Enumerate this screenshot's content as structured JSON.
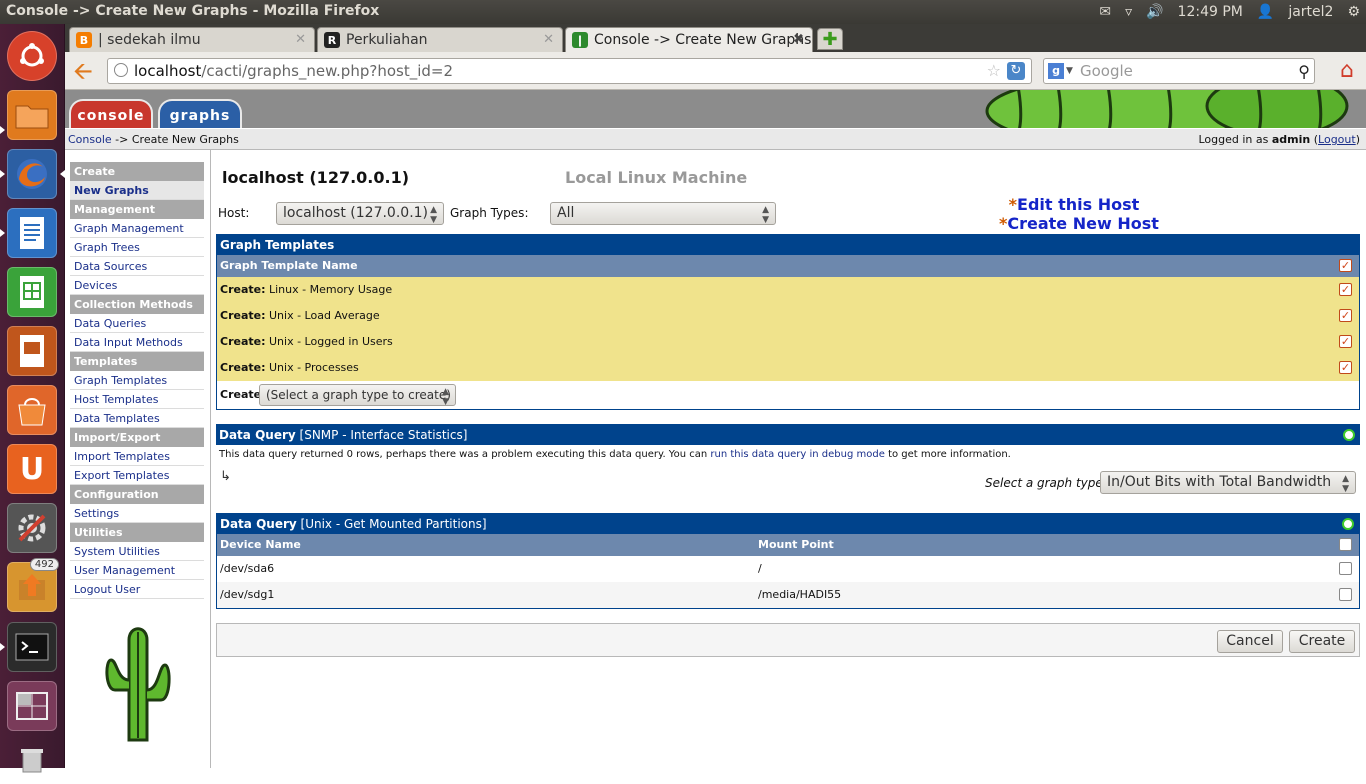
{
  "window": {
    "title": "Console -> Create New Graphs - Mozilla Firefox"
  },
  "tray": {
    "clock": "12:49 PM",
    "user": "jartel2"
  },
  "launcher": {
    "badge": "492"
  },
  "tabs": [
    {
      "label": "| sedekah ilmu"
    },
    {
      "label": "Perkuliahan"
    },
    {
      "label": "Console -> Create New Graphs"
    }
  ],
  "url": {
    "host": "localhost",
    "path": "/cacti/graphs_new.php?host_id=2"
  },
  "search": {
    "placeholder": "Google"
  },
  "cacti_tabs": {
    "console": "console",
    "graphs": "graphs"
  },
  "breadcrumb": {
    "console": "Console",
    "rest": " -> Create New Graphs"
  },
  "login": {
    "prefix": "Logged in as ",
    "user": "admin",
    "logout": "Logout"
  },
  "nav": [
    {
      "type": "head",
      "label": "Create"
    },
    {
      "type": "item",
      "label": "New Graphs",
      "selected": true
    },
    {
      "type": "head",
      "label": "Management"
    },
    {
      "type": "item",
      "label": "Graph Management"
    },
    {
      "type": "item",
      "label": "Graph Trees"
    },
    {
      "type": "item",
      "label": "Data Sources"
    },
    {
      "type": "item",
      "label": "Devices"
    },
    {
      "type": "head",
      "label": "Collection Methods"
    },
    {
      "type": "item",
      "label": "Data Queries"
    },
    {
      "type": "item",
      "label": "Data Input Methods"
    },
    {
      "type": "head",
      "label": "Templates"
    },
    {
      "type": "item",
      "label": "Graph Templates"
    },
    {
      "type": "item",
      "label": "Host Templates"
    },
    {
      "type": "item",
      "label": "Data Templates"
    },
    {
      "type": "head",
      "label": "Import/Export"
    },
    {
      "type": "item",
      "label": "Import Templates"
    },
    {
      "type": "item",
      "label": "Export Templates"
    },
    {
      "type": "head",
      "label": "Configuration"
    },
    {
      "type": "item",
      "label": "Settings"
    },
    {
      "type": "head",
      "label": "Utilities"
    },
    {
      "type": "item",
      "label": "System Utilities"
    },
    {
      "type": "item",
      "label": "User Management"
    },
    {
      "type": "item",
      "label": "Logout User"
    }
  ],
  "host": {
    "title": "localhost (127.0.0.1)",
    "description": "Local Linux Machine",
    "host_label": "Host:",
    "host_value": "localhost (127.0.0.1)",
    "types_label": "Graph Types:",
    "types_value": "All",
    "edit_link": "Edit this Host",
    "create_link": "Create New Host"
  },
  "graph_templates": {
    "title": "Graph Templates",
    "column": "Graph Template Name",
    "create_prefix": "Create:",
    "rows": [
      " Linux - Memory Usage",
      " Unix - Load Average",
      " Unix - Logged in Users",
      " Unix - Processes"
    ],
    "create_label": "Create:",
    "create_select": "(Select a graph type to create)"
  },
  "dq_snmp": {
    "title_bold": "Data Query",
    "title_rest": " [SNMP - Interface Statistics]",
    "msg_pre": "This data query returned 0 rows, perhaps there was a problem executing this data query. You can ",
    "msg_link": "run this data query in debug mode",
    "msg_post": " to get more information.",
    "select_label": "Select a graph type:",
    "select_value": "In/Out Bits with Total Bandwidth"
  },
  "dq_unix": {
    "title_bold": "Data Query",
    "title_rest": " [Unix - Get Mounted Partitions]",
    "col_device": "Device Name",
    "col_mount": "Mount Point",
    "rows": [
      {
        "device": "/dev/sda6",
        "mount": "/"
      },
      {
        "device": "/dev/sdg1",
        "mount": "/media/HADI55"
      }
    ]
  },
  "buttons": {
    "cancel": "Cancel",
    "create": "Create"
  },
  "colors": {
    "header_blue": "#00438C",
    "subhead": "#6D88AD",
    "yellow_row": "#F0E38C",
    "console_tab": "#C8372D",
    "graphs_tab": "#2B5FA6"
  }
}
